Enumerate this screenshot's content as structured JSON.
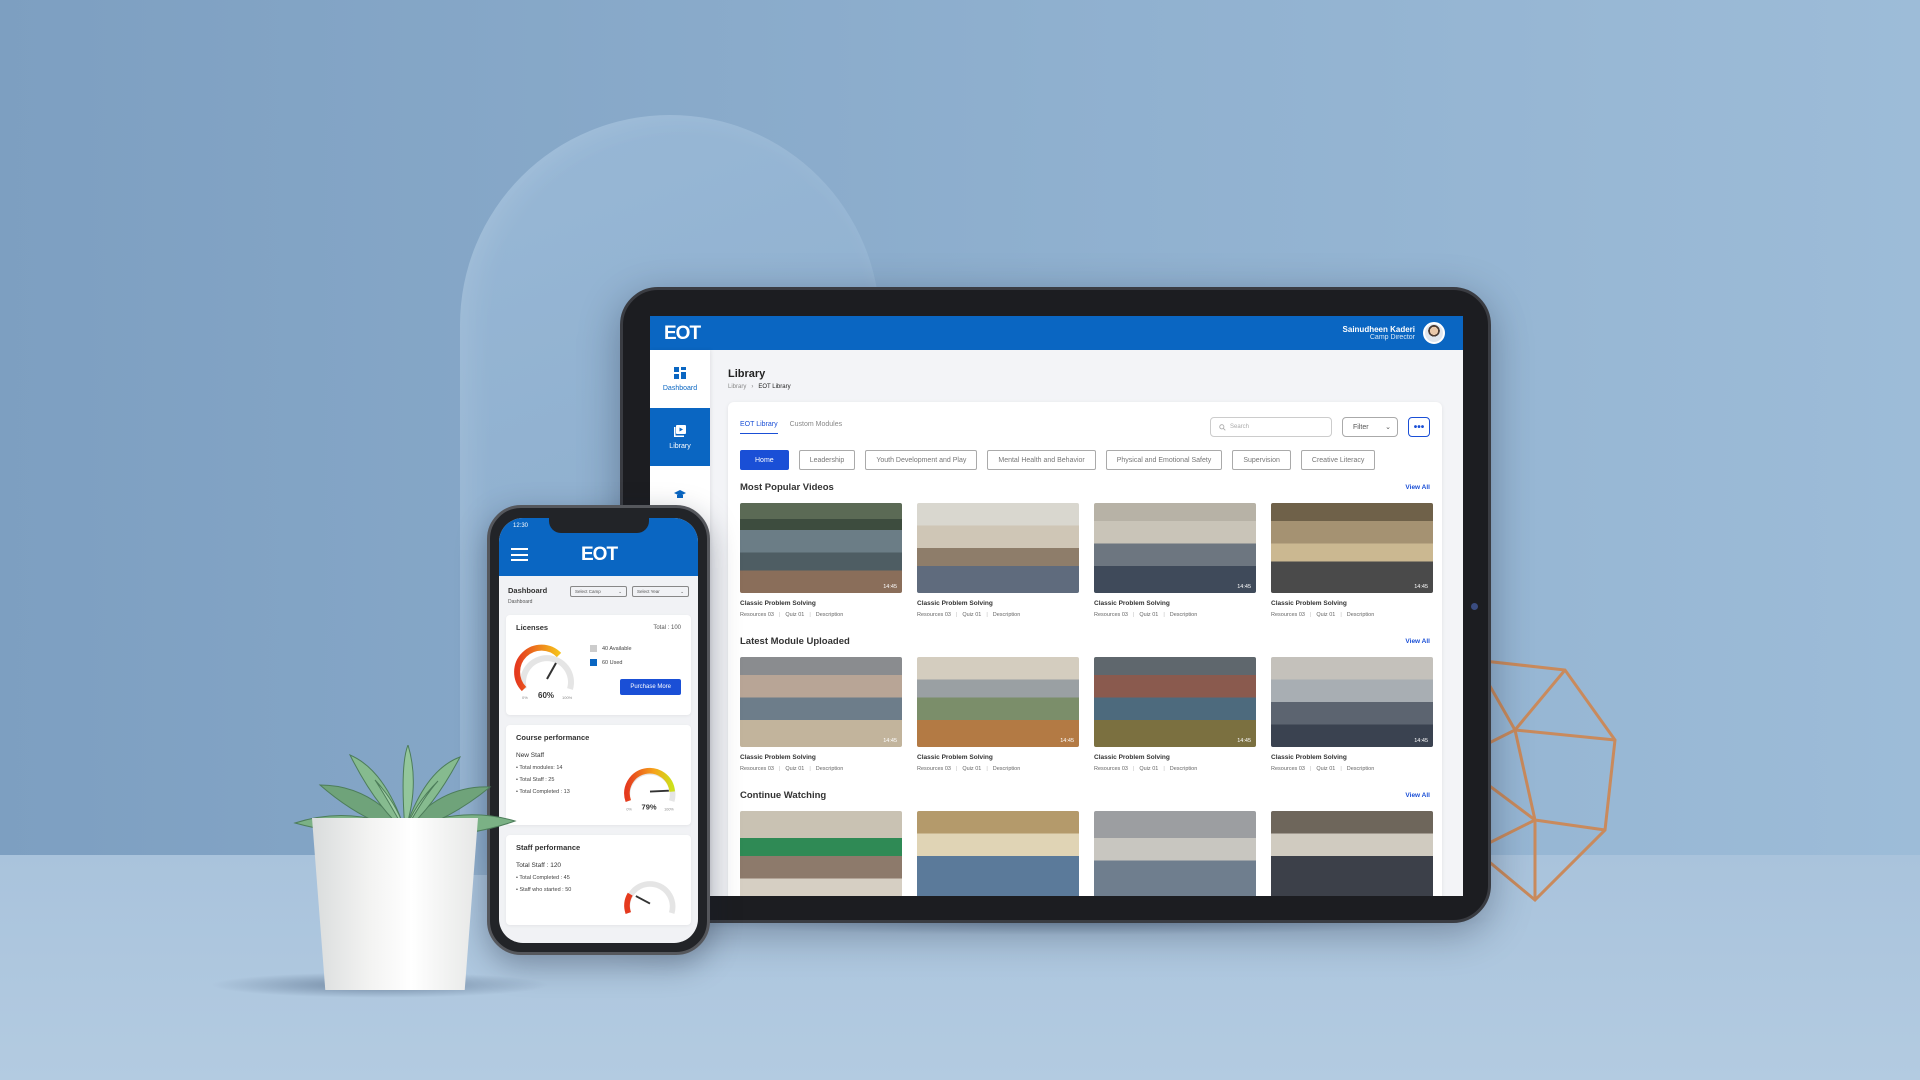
{
  "colors": {
    "brand_blue": "#0a66c2",
    "accent_blue": "#1a4fd6",
    "background": "#86a7c6"
  },
  "tablet": {
    "logo": "EOT",
    "user": {
      "name": "Sainudheen Kaderi",
      "role": "Camp Director"
    },
    "nav": [
      {
        "label": "Dashboard",
        "icon": "grid-icon",
        "active": false
      },
      {
        "label": "Library",
        "icon": "video-library-icon",
        "active": true
      },
      {
        "label": "",
        "icon": "graduation-cap-icon",
        "active": false
      }
    ],
    "page_title": "Library",
    "breadcrumb": [
      "Library",
      "EOT Library"
    ],
    "tabs": [
      "EOT Library",
      "Custom Modules"
    ],
    "search_placeholder": "Search",
    "filter_label": "Filter",
    "more_label": "•••",
    "chips": [
      "Home",
      "Leadership",
      "Youth Development and Play",
      "Mental Health and Behavior",
      "Physical and Emotional Safety",
      "Supervision",
      "Creative Literacy"
    ],
    "view_all": "View All",
    "sections": [
      {
        "title": "Most Popular Videos",
        "videos": [
          {
            "title": "Classic Problem Solving",
            "duration": "14:45",
            "resources": "Resources 03",
            "quiz": "Quiz 01",
            "description": "Description"
          },
          {
            "title": "Classic Problem Solving",
            "duration": "",
            "resources": "Resources 03",
            "quiz": "Quiz 01",
            "description": "Description"
          },
          {
            "title": "Classic Problem Solving",
            "duration": "14:45",
            "resources": "Resources 03",
            "quiz": "Quiz 01",
            "description": "Description"
          },
          {
            "title": "Classic Problem Solving",
            "duration": "14:45",
            "resources": "Resources 03",
            "quiz": "Quiz 01",
            "description": "Description"
          }
        ]
      },
      {
        "title": "Latest Module Uploaded",
        "videos": [
          {
            "title": "Classic Problem Solving",
            "duration": "14:45",
            "resources": "Resources 03",
            "quiz": "Quiz 01",
            "description": "Description"
          },
          {
            "title": "Classic Problem Solving",
            "duration": "14:45",
            "resources": "Resources 03",
            "quiz": "Quiz 01",
            "description": "Description"
          },
          {
            "title": "Classic Problem Solving",
            "duration": "14:45",
            "resources": "Resources 03",
            "quiz": "Quiz 01",
            "description": "Description"
          },
          {
            "title": "Classic Problem Solving",
            "duration": "14:45",
            "resources": "Resources 03",
            "quiz": "Quiz 01",
            "description": "Description"
          }
        ]
      },
      {
        "title": "Continue Watching",
        "videos": []
      }
    ]
  },
  "phone": {
    "time": "12:30",
    "logo": "EOT",
    "title": "Dashboard",
    "breadcrumb": "Dashboard",
    "select_camp": "Select Camp",
    "select_year": "Select Year",
    "licenses": {
      "title": "Licenses",
      "total": "Total : 100",
      "available": "40 Available",
      "used": "60 Used",
      "percent_label": "60%",
      "gauge_value": 0.6,
      "gauge_min": "0%",
      "gauge_max": "100%",
      "button": "Purchase More"
    },
    "course": {
      "title": "Course performance",
      "subtitle": "New Staff",
      "items": [
        "Total modules: 14",
        "Total Staff : 25",
        "Total Completed : 13"
      ],
      "percent_label": "79%",
      "gauge_value": 0.79,
      "gauge_min": "0%",
      "gauge_max": "100%"
    },
    "staff": {
      "title": "Staff performance",
      "subtitle": "Total Staff : 120",
      "items": [
        "Total Completed : 45",
        "Staff who started : 50"
      ]
    }
  }
}
